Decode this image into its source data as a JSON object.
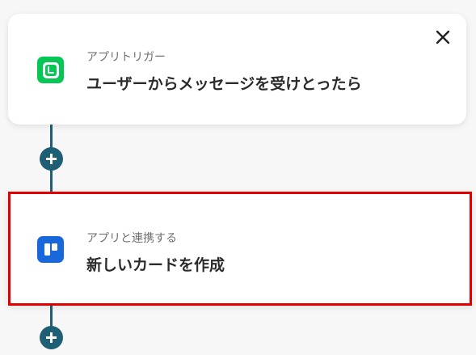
{
  "trigger_card": {
    "subtitle": "アプリトリガー",
    "title": "ユーザーからメッセージを受けとったら",
    "icon": "line-app-icon",
    "close_icon": "close-icon",
    "accent_color": "#06c755"
  },
  "action_card": {
    "subtitle": "アプリと連携する",
    "title": "新しいカードを作成",
    "icon": "trello-app-icon",
    "highlight_color": "#e00000",
    "accent_color": "#1868db"
  },
  "connector_color": "#1f5f75",
  "add_step_icon": "plus-icon"
}
